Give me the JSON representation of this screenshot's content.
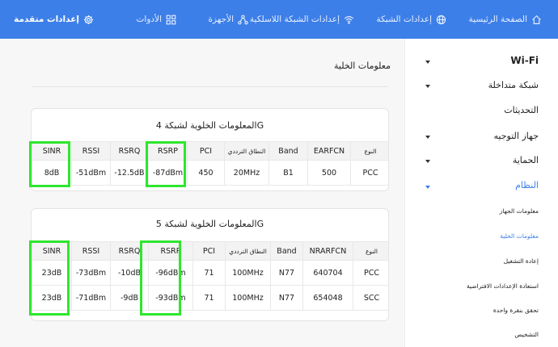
{
  "nav": {
    "home": "الصفحة الرئيسية",
    "network_settings": "إعدادات الشبكة",
    "wireless_settings": "إعدادات الشبكة اللاسلكية",
    "devices": "الأجهزة",
    "tools": "الأدوات",
    "advanced_settings": "إعدادات متقدمة"
  },
  "page": {
    "section_title": "معلومات الخلية"
  },
  "cell_4g": {
    "title": "المعلومات الخلوية لشبكة 4G",
    "headers": [
      "النوع",
      "EARFCN",
      "Band",
      "النطاق الترددي",
      "PCI",
      "RSRP",
      "RSRQ",
      "RSSI",
      "SINR"
    ],
    "rows": [
      [
        "PCC",
        "500",
        "B1",
        "20MHz",
        "450",
        "-87dBm",
        "-12.5dB",
        "-51dBm",
        "8dB"
      ]
    ]
  },
  "cell_5g": {
    "title": "المعلومات الخلوية لشبكة 5G",
    "headers": [
      "النوع",
      "NRARFCN",
      "Band",
      "النطاق الترددي",
      "PCI",
      "RSRP",
      "RSRQ",
      "RSSI",
      "SINR"
    ],
    "rows": [
      [
        "PCC",
        "640704",
        "N77",
        "100MHz",
        "71",
        "-96dBm",
        "-10dB",
        "-73dBm",
        "23dB"
      ],
      [
        "SCC",
        "654048",
        "N77",
        "100MHz",
        "71",
        "-93dBm",
        "-9dB",
        "-71dBm",
        "23dB"
      ]
    ]
  },
  "sidebar": {
    "wifi": "Wi-Fi",
    "mesh": "شبكة متداخلة",
    "updates": "التحديثات",
    "router": "جهاز التوجيه",
    "security": "الحماية",
    "system": "النظام",
    "sub": {
      "device_info": "معلومات الجهاز",
      "cell_info": "معلومات الخلية",
      "reboot": "إعادة التشغيل",
      "factory_reset": "استعادة الإعدادات الافتراضية",
      "one_click_check": "تحقق بنقرة واحدة",
      "diagnostics": "التشخيص"
    }
  },
  "colors": {
    "nav_bg": "#3d7fe8",
    "accent": "#3d7fe8",
    "highlight_box": "#2ee62e"
  },
  "icons": {
    "home": "home-icon",
    "network_settings": "globe-icon",
    "wireless_settings": "wifi-icon",
    "devices": "network-topology-icon",
    "tools": "grid-tools-icon",
    "advanced_settings": "gear-icon"
  }
}
